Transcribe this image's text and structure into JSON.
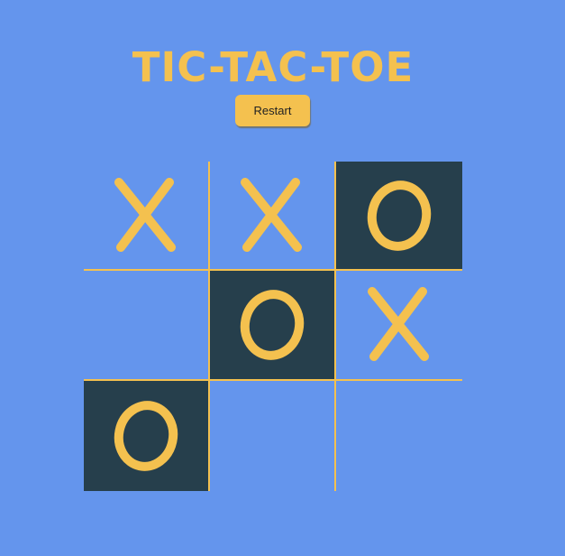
{
  "game": {
    "title": "TIC-TAC-TOE",
    "restart_label": "Restart"
  },
  "colors": {
    "background": "#6495ed",
    "accent": "#f4c14f",
    "highlight_cell": "#263f4c"
  },
  "board": {
    "cells": [
      {
        "mark": "X",
        "highlighted": false
      },
      {
        "mark": "X",
        "highlighted": false
      },
      {
        "mark": "O",
        "highlighted": true
      },
      {
        "mark": "",
        "highlighted": false
      },
      {
        "mark": "O",
        "highlighted": true
      },
      {
        "mark": "X",
        "highlighted": false
      },
      {
        "mark": "O",
        "highlighted": true
      },
      {
        "mark": "",
        "highlighted": false
      },
      {
        "mark": "",
        "highlighted": false
      }
    ]
  }
}
